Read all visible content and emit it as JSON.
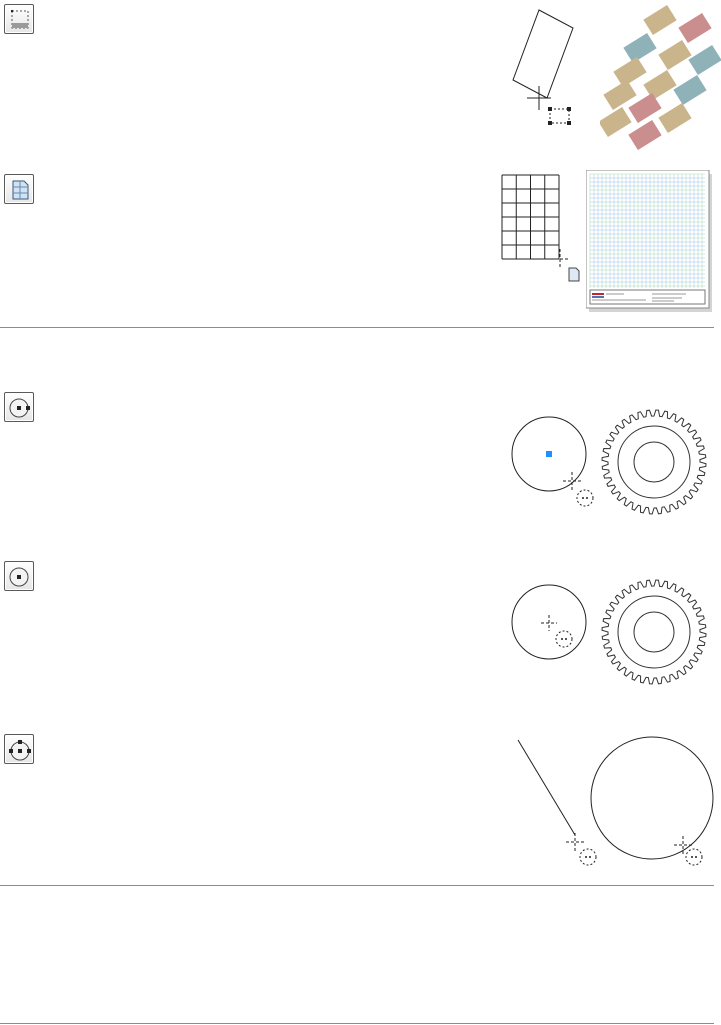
{
  "tools": [
    {
      "name": "rectangle-select-tool",
      "icon": "rectangle-select-icon"
    },
    {
      "name": "sheet-tool",
      "icon": "sheet-icon"
    },
    {
      "name": "circle-tool",
      "icon": "circle-icon"
    },
    {
      "name": "circle-center-tool",
      "icon": "circle-center-icon"
    },
    {
      "name": "three-point-circle-tool",
      "icon": "three-point-circle-icon"
    }
  ],
  "colors": {
    "tan": "#c9b48b",
    "blue": "#8fb2b9",
    "red": "#cb8e8e",
    "marker": "#1e90ff",
    "grid_blue": "#9fc4e6",
    "grid_green": "#a9d8a9",
    "rule": "#8c8c8c"
  }
}
